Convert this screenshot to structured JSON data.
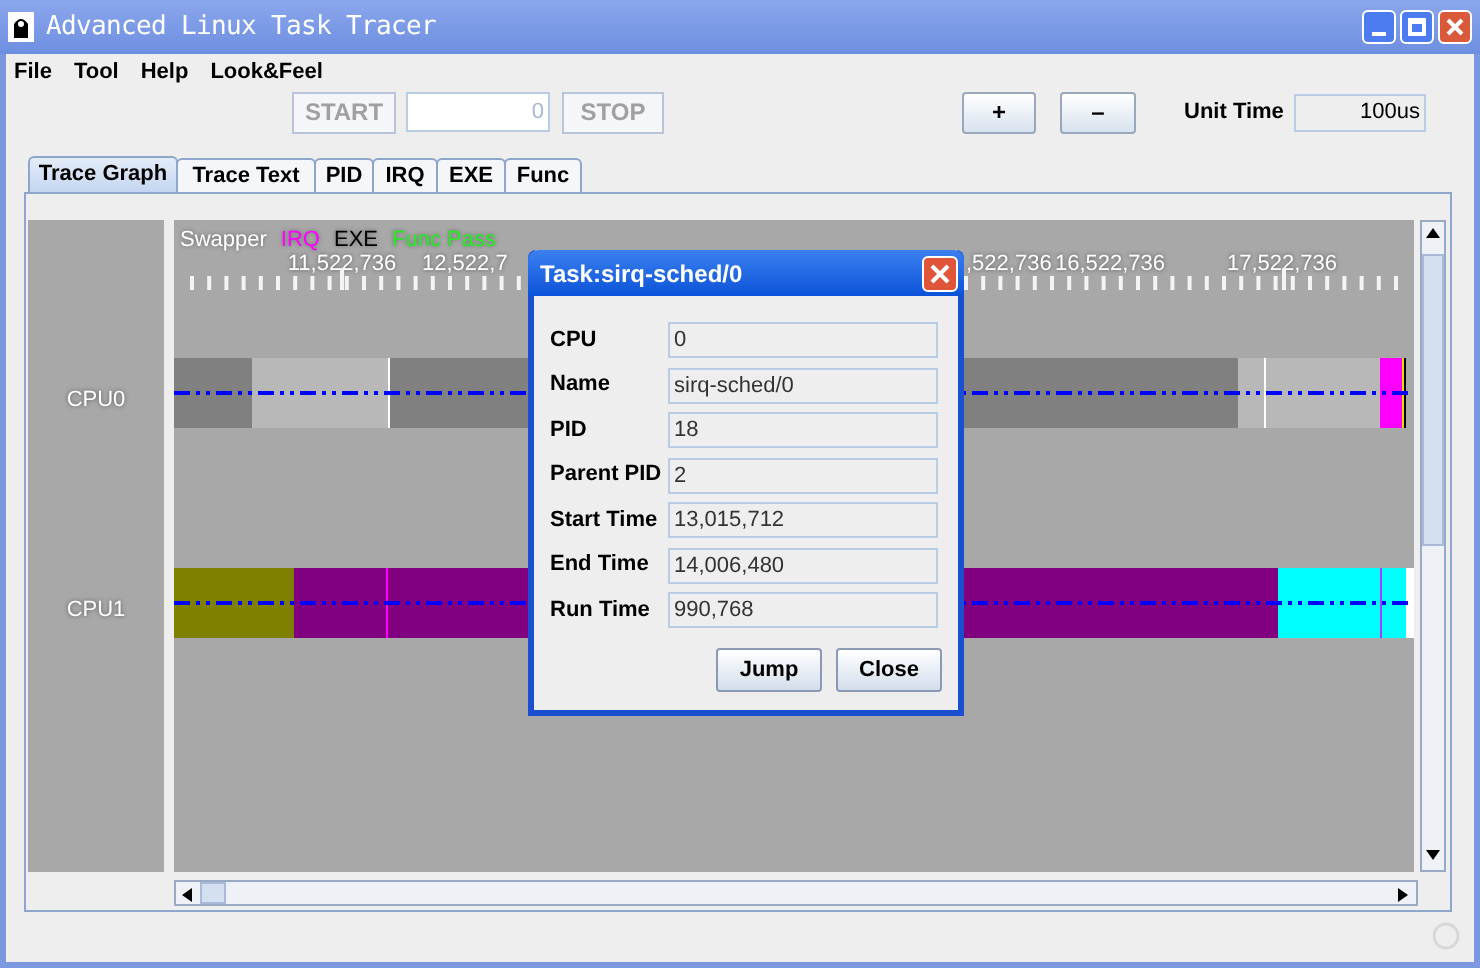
{
  "window": {
    "title": "Advanced Linux Task Tracer"
  },
  "menu": [
    "File",
    "Tool",
    "Help",
    "Look&Feel"
  ],
  "toolbar": {
    "start_button": {
      "label": "START",
      "disabled": true
    },
    "counter": {
      "value": "0",
      "disabled": true
    },
    "stop_button": {
      "label": "STOP",
      "disabled": true
    },
    "zoom_in": "+",
    "zoom_out": "–",
    "unit_time": {
      "label": "Unit Time",
      "value": "100us"
    }
  },
  "tabs": [
    {
      "label": "Trace Graph",
      "selected": true
    },
    {
      "label": "Trace Text",
      "selected": false
    },
    {
      "label": "PID",
      "selected": false
    },
    {
      "label": "IRQ",
      "selected": false
    },
    {
      "label": "EXE",
      "selected": false
    },
    {
      "label": "Func",
      "selected": false
    }
  ],
  "trace": {
    "legend": [
      {
        "label": "Swapper",
        "color": "#ffffff"
      },
      {
        "label": "IRQ",
        "color": "#ff00ff"
      },
      {
        "label": "EXE",
        "color": "#000000"
      },
      {
        "label": "Func Pass",
        "color": "#22ee22"
      }
    ],
    "ticks": [
      "11,522,736",
      "12,522,7",
      ",522,736",
      "16,522,736",
      "17,522,736"
    ],
    "cpus": [
      "CPU0",
      "CPU1"
    ]
  },
  "dialog": {
    "title": "Task:sirq-sched/0",
    "fields": [
      {
        "label": "CPU",
        "value": "0"
      },
      {
        "label": "Name",
        "value": "sirq-sched/0"
      },
      {
        "label": "PID",
        "value": "18"
      },
      {
        "label": "Parent PID",
        "value": "2"
      },
      {
        "label": "Start Time",
        "value": "13,015,712"
      },
      {
        "label": "End Time",
        "value": "14,006,480"
      },
      {
        "label": "Run Time",
        "value": "990,768"
      }
    ],
    "buttons": [
      "Jump",
      "Close"
    ]
  }
}
